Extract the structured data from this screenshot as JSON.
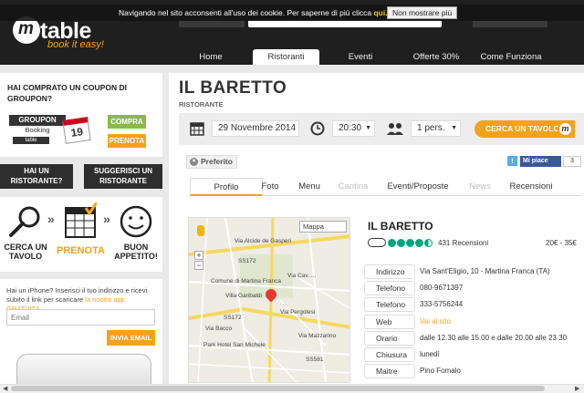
{
  "cookie": {
    "text": "Navigando nel sito acconsenti all'uso dei cookie. Per saperne di più clicca",
    "link": "qui.",
    "button": "Non mostrare più"
  },
  "logo": {
    "word": "table",
    "tagline": "book it easy!"
  },
  "nav": [
    {
      "label": "Home"
    },
    {
      "label": "Ristoranti"
    },
    {
      "label": "Eventi"
    },
    {
      "label": "Offerte 30%"
    },
    {
      "label": "Come Funziona"
    }
  ],
  "sidebar": {
    "coupon_title": "HAI COMPRATO UN COUPON DI GROUPON?",
    "groupon_brand": "GROUPON",
    "groupon_sub": "Booking",
    "groupon_mini": "table",
    "groupon_cal": "19",
    "compra": "COMPRA",
    "prenota": "PRENOTA",
    "hai_ristorante": "HAI UN RISTORANTE?",
    "suggerisci": "SUGGERISCI UN RISTORANTE",
    "steps": [
      "CERCA UN TAVOLO",
      "PRENOTA",
      "BUON APPETITO!"
    ],
    "app_text": "Hai un iPhone? Inserisci il tuo indirizzo e ricevi subito il link per scaricare",
    "app_link": "la nostra app GRATUITA",
    "email_placeholder": "Email",
    "invia": "INVIA EMAIL"
  },
  "restaurant": {
    "title": "IL BARETTO",
    "subtitle": "RISTORANTE"
  },
  "booking": {
    "date": "29 Novembre 2014",
    "time": "20:30",
    "people": "1 pers.",
    "cta": "CERCA UN TAVOLO"
  },
  "social": {
    "preferito": "Preferito",
    "fb": "Mi piace",
    "fb_count": "3"
  },
  "tabs": [
    {
      "label": "Profilo",
      "state": "active"
    },
    {
      "label": "Foto",
      "state": "normal"
    },
    {
      "label": "Menu",
      "state": "normal"
    },
    {
      "label": "Cantina",
      "state": "disabled"
    },
    {
      "label": "Eventi/Proposte",
      "state": "normal"
    },
    {
      "label": "News",
      "state": "disabled"
    },
    {
      "label": "Recensioni",
      "state": "normal"
    }
  ],
  "map": {
    "type": "Mappa",
    "labels": [
      "Via Alcide de Gasperi",
      "SS172",
      "Comune di Martina Franca",
      "Villa Garibaldi",
      "Via Cav. ...",
      "SS172",
      "Park Hotel San Michele",
      "SS581",
      "Via Mazzarino",
      "Via Pergolesi",
      "Via Bacco"
    ]
  },
  "info": {
    "name": "IL BARETTO",
    "rating": 4.5,
    "reviews": "431 Recensioni",
    "price": "20€ - 35€",
    "rows": [
      {
        "key": "Indirizzo",
        "value": "Via Sant'Eligio, 10 - Martina Franca (TA)"
      },
      {
        "key": "Telefono",
        "value": "080-9671397"
      },
      {
        "key": "Telefono",
        "value": "333-5756244"
      },
      {
        "key": "Web",
        "value": "Vai al sito"
      },
      {
        "key": "Orario",
        "value": "dalle 12.30 alle 15.00 e dalle 20.00 alle 23.30"
      },
      {
        "key": "Chiusura",
        "value": "lunedì"
      },
      {
        "key": "Maitre",
        "value": "Pino Fomalo"
      }
    ]
  },
  "colors": {
    "accent": "#f4a21c",
    "green": "#8cb94a",
    "dark": "#1f1f1f",
    "tripadvisor": "#00a680"
  }
}
